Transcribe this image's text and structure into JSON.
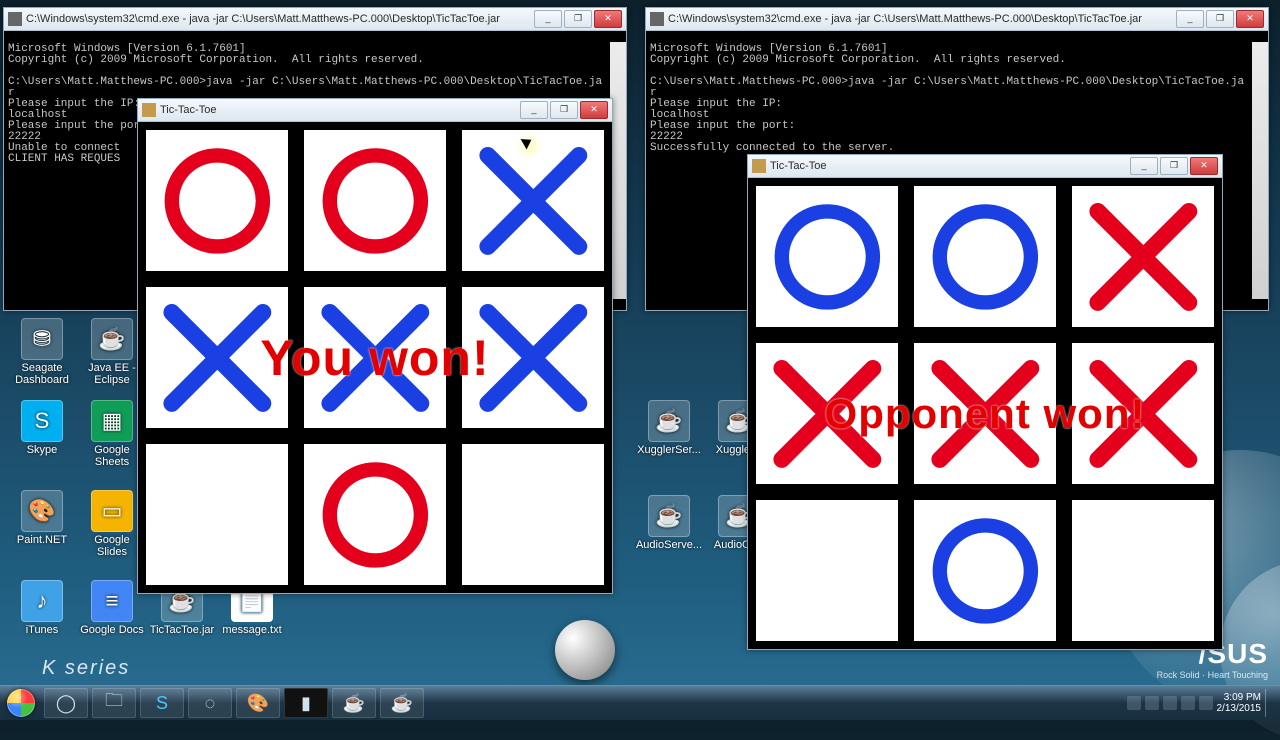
{
  "colors": {
    "circle_red": "#e4001d",
    "x_blue": "#1a3fe3",
    "circle_blue": "#1a3fe3",
    "x_red": "#e4001d"
  },
  "console_left": {
    "title": "C:\\Windows\\system32\\cmd.exe - java  -jar C:\\Users\\Matt.Matthews-PC.000\\Desktop\\TicTacToe.jar",
    "lines": [
      "Microsoft Windows [Version 6.1.7601]",
      "Copyright (c) 2009 Microsoft Corporation.  All rights reserved.",
      "",
      "C:\\Users\\Matt.Matthews-PC.000>java -jar C:\\Users\\Matt.Matthews-PC.000\\Desktop\\TicTacToe.jar",
      "Please input the IP:",
      "localhost",
      "Please input the port:",
      "22222",
      "Unable to connect",
      "CLIENT HAS REQUES"
    ]
  },
  "console_right": {
    "title": "C:\\Windows\\system32\\cmd.exe - java  -jar C:\\Users\\Matt.Matthews-PC.000\\Desktop\\TicTacToe.jar",
    "lines": [
      "Microsoft Windows [Version 6.1.7601]",
      "Copyright (c) 2009 Microsoft Corporation.  All rights reserved.",
      "",
      "C:\\Users\\Matt.Matthews-PC.000>java -jar C:\\Users\\Matt.Matthews-PC.000\\Desktop\\TicTacToe.jar",
      "Please input the IP:",
      "localhost",
      "Please input the port:",
      "22222",
      "Successfully connected to the server."
    ]
  },
  "game_left": {
    "title": "Tic-Tac-Toe",
    "message": "You won!",
    "cells": [
      {
        "mark": "O",
        "color": "red"
      },
      {
        "mark": "O",
        "color": "red"
      },
      {
        "mark": "X",
        "color": "blue"
      },
      {
        "mark": "X",
        "color": "blue"
      },
      {
        "mark": "X",
        "color": "blue"
      },
      {
        "mark": "X",
        "color": "blue"
      },
      {
        "mark": "",
        "color": ""
      },
      {
        "mark": "O",
        "color": "red"
      },
      {
        "mark": "",
        "color": ""
      }
    ]
  },
  "game_right": {
    "title": "Tic-Tac-Toe",
    "message": "Opponent won!",
    "cells": [
      {
        "mark": "O",
        "color": "blue"
      },
      {
        "mark": "O",
        "color": "blue"
      },
      {
        "mark": "X",
        "color": "red"
      },
      {
        "mark": "X",
        "color": "red"
      },
      {
        "mark": "X",
        "color": "red"
      },
      {
        "mark": "X",
        "color": "red"
      },
      {
        "mark": "",
        "color": ""
      },
      {
        "mark": "O",
        "color": "blue"
      },
      {
        "mark": "",
        "color": ""
      }
    ]
  },
  "desktop_icons": [
    {
      "label": "Seagate Dashboard"
    },
    {
      "label": "Java EE - Eclipse"
    },
    {
      "label": "Skype"
    },
    {
      "label": "Google Sheets"
    },
    {
      "label": "Paint.NET"
    },
    {
      "label": "Google Slides"
    },
    {
      "label": "iTunes"
    },
    {
      "label": "Google Docs"
    },
    {
      "label": "TicTacToe.jar"
    },
    {
      "label": "message.txt"
    },
    {
      "label": "XugglerSer..."
    },
    {
      "label": "Xuggler..."
    },
    {
      "label": "AudioServe..."
    },
    {
      "label": "AudioCli..."
    }
  ],
  "window_buttons": {
    "min": "_",
    "max": "❐",
    "close": "✕"
  },
  "tray": {
    "time": "3:09 PM",
    "date": "2/13/2015"
  },
  "brand": {
    "name": "/SUS",
    "tag": "Rock Solid · Heart Touching"
  },
  "kseries": "K series"
}
